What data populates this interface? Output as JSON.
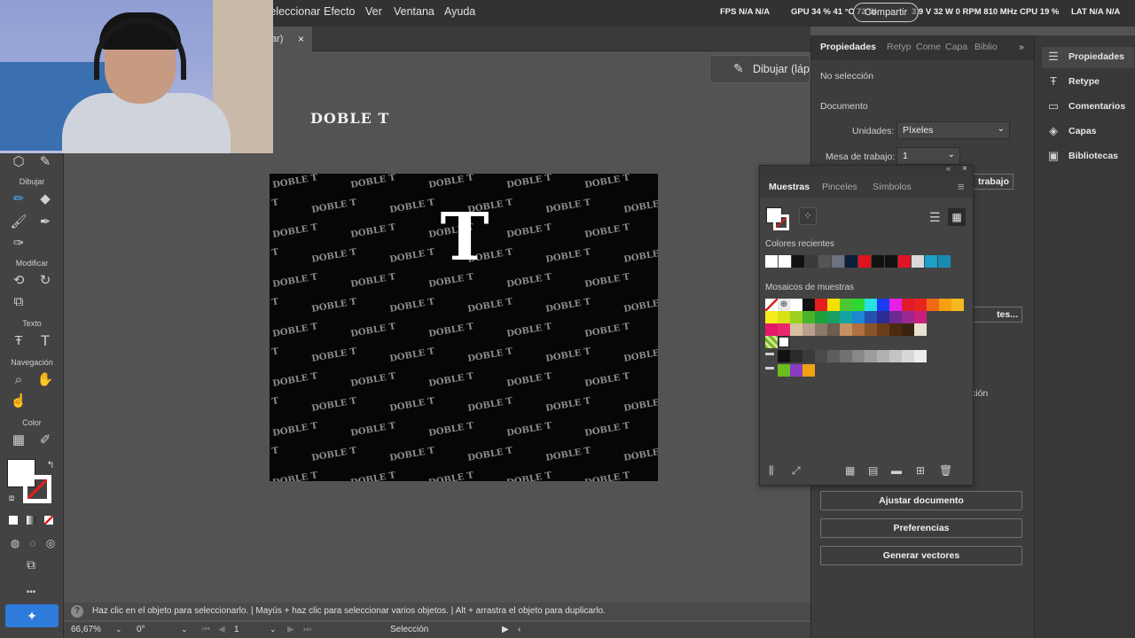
{
  "menu": {
    "items": [
      "Seleccionar",
      "Efecto",
      "Ver",
      "Ventana",
      "Ayuda"
    ],
    "share_label": "Compartir"
  },
  "overlay": {
    "fps": "FPS N/A N/A",
    "gpu": "GPU 34 % 41 °C 72 W",
    "vram": "3,9 V 32 W 0 RPM 810 MHz",
    "cpu": "CPU 19 %",
    "lat": "LAT N/A N/A"
  },
  "doc_tab": {
    "label": "ar)",
    "close": "×"
  },
  "toolbar": {
    "sections": {
      "draw": "Dibujar",
      "modify": "Modificar",
      "text": "Texto",
      "nav": "Navegación",
      "color": "Color"
    },
    "more": "•••"
  },
  "draw_pill": {
    "label": "Dibujar (láp"
  },
  "canvas": {
    "title": "DOBLE T",
    "logo_letter": "T",
    "pattern_text": "DOBLE T"
  },
  "properties": {
    "tabs": [
      "Propiedades",
      "Retype",
      "Comentarios",
      "Capas",
      "Bibliotecas"
    ],
    "tabs_short": [
      "Propiedades",
      "Retyp",
      "Come",
      "Capa",
      "Biblio"
    ],
    "no_selection": "No selección",
    "document_label": "Documento",
    "units_label": "Unidades:",
    "units_value": "Píxeles",
    "artboard_label": "Mesa de trabajo:",
    "artboard_value": "1",
    "edit_artboards_partial": "trabajo",
    "partial_btn": "tes...",
    "partial_text": "ción",
    "buttons": {
      "fit_document": "Ajustar documento",
      "preferences": "Preferencias",
      "generate_vectors": "Generar vectores"
    }
  },
  "side_panel": {
    "items": [
      "Propiedades",
      "Retype",
      "Comentarios",
      "Capas",
      "Bibliotecas"
    ]
  },
  "swatches": {
    "tabs": [
      "Muestras",
      "Pinceles",
      "Símbolos"
    ],
    "recent_label": "Colores recientes",
    "library_label": "Mosaicos de muestras",
    "recent_colors": [
      "#ffffff",
      "#ffffff",
      "#111111",
      "#3a3a3a",
      "#555555",
      "#6d7280",
      "#0c1f3a",
      "#e0121c",
      "#111111",
      "#111111",
      "#e01424",
      "#d9d9d9",
      "#1ba0c8",
      "#1a8ab0"
    ],
    "grid_row1": [
      "#111111",
      "#e41e1e",
      "#f6e000",
      "#4ec832",
      "#2ed830",
      "#28e0e0",
      "#1a3cf0",
      "#e820e6",
      "#e01c2c",
      "#e82420",
      "#f06a18",
      "#f4a010",
      "#f4b820"
    ],
    "grid_row2": [
      "#f4ec1c",
      "#d8e018",
      "#9cd020",
      "#48b42c",
      "#1ea03a",
      "#18a064",
      "#14a4a0",
      "#1c88d4",
      "#2650b0",
      "#2c2c94",
      "#6a2a90",
      "#9a2890",
      "#c82078"
    ],
    "grid_row3": [
      "#e4186a",
      "#e8286a",
      "#d6c0a0",
      "#b8a08c",
      "#8a7a6a",
      "#6c5e50",
      "#c89060",
      "#b07040",
      "#8a5428",
      "#6c3c18",
      "#4c2a10",
      "#3a2210",
      "#e8e0d0"
    ],
    "gray_row": [
      "#111111",
      "#2a2a2a",
      "#3a3a3a",
      "#4a4a4a",
      "#5e5e5e",
      "#727272",
      "#888888",
      "#9c9c9c",
      "#b0b0b0",
      "#c4c4c4",
      "#d8d8d8",
      "#ececec"
    ],
    "group_row": [
      "#6cbc20",
      "#8a3cc0",
      "#f0a010"
    ]
  },
  "hint": {
    "text": "Haz clic en el objeto para seleccionarlo.  |  Mayús + haz clic para seleccionar varios objetos.  |  Alt + arrastra el objeto para duplicarlo."
  },
  "status": {
    "zoom": "66,67%",
    "rotation": "0°",
    "artboard": "1",
    "tool": "Selección"
  }
}
